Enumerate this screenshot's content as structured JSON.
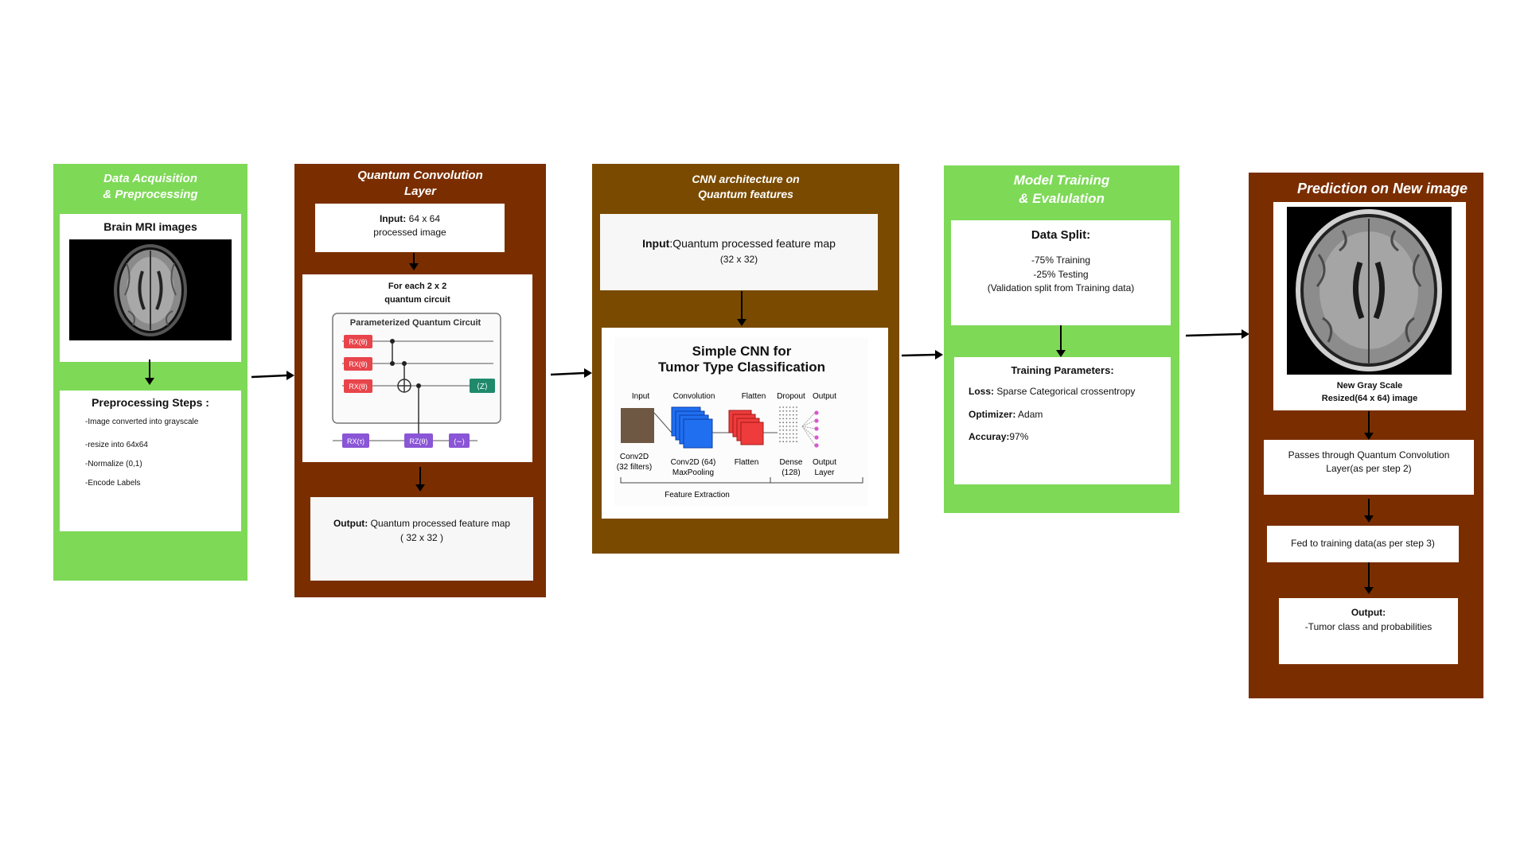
{
  "colors": {
    "green": "#7ed957",
    "brown": "#7a2e00",
    "olive": "#7a4a00",
    "gate_red": "#e8444b",
    "gate_green": "#1f8a6b",
    "gate_purple": "#8a55d6",
    "cnn_blue": "#1f6ff0",
    "cnn_red": "#ee3b3b",
    "cnn_brown": "#6e5843",
    "dot_pink": "#d65ad0"
  },
  "p1": {
    "title_line1": "Data Acquisition",
    "title_line2": "& Preprocessing",
    "mri_label": "Brain MRI images",
    "steps_title": "Preprocessing Steps :",
    "steps": [
      "-Image converted into grayscale",
      "-resize into 64x64",
      "-Normalize (0,1)",
      "-Encode Labels"
    ]
  },
  "p2": {
    "title_line1": "Quantum Convolution",
    "title_line2": "Layer",
    "input_bold": "Input:",
    "input_rest": "64 x 64",
    "input_line2": "processed image",
    "circuit_head1": "For each 2 x 2",
    "circuit_head2": "quantum circuit",
    "circuit_title": "Parameterized Quantum Circuit",
    "gate_rx": "RX(θ)",
    "gate_z": "⟨Z⟩",
    "gate_rx_bottom": "RX(τ)",
    "gate_rz": "RZ(θ)",
    "gate_small": "(∼)",
    "output_bold": "Output:",
    "output_rest": "Quantum processed feature map",
    "output_line2": "( 32 x 32 )"
  },
  "p3": {
    "title_line1": "CNN architecture on",
    "title_line2": "Quantum features",
    "input_bold": "Input",
    "input_rest": ":Quantum processed feature map",
    "input_line2": "(32 x 32)",
    "cnn_title1": "Simple CNN for",
    "cnn_title2": "Tumor Type Classification",
    "col_headers": [
      "Input",
      "Convolution",
      "Flatten",
      "Dropout",
      "Output"
    ],
    "labels": {
      "conv2d_a": "Conv2D",
      "conv2d_b": "(32 filters)",
      "conv64_a": "Conv2D (64)",
      "conv64_b": "MaxPooling",
      "flatten": "Flatten",
      "dense_a": "Dense",
      "dense_b": "(128)",
      "out_a": "Output",
      "out_b": "Layer"
    },
    "feature_extraction": "Feature Extraction"
  },
  "p4": {
    "title_line1": "Model  Training",
    "title_line2": "& Evalulation",
    "split_title": "Data Split:",
    "split_lines": [
      "-75% Training",
      "-25% Testing",
      "(Validation split from Training data)"
    ],
    "params_title": "Training Parameters:",
    "params": [
      {
        "key": "Loss:",
        "value": " Sparse Categorical crossentropy"
      },
      {
        "key": "Optimizer:",
        "value": " Adam"
      },
      {
        "key": "Accuray:",
        "value": "97%"
      }
    ]
  },
  "p5": {
    "title": "Prediction on New image",
    "img_caption1": "New Gray Scale",
    "img_caption2": "Resized(64 x 64) image",
    "step1": "Passes through Quantum Convolution Layer(as per step 2)",
    "step2": "Fed to training data(as per step 3)",
    "output_bold": "Output:",
    "output_rest": "-Tumor class and probabilities"
  }
}
